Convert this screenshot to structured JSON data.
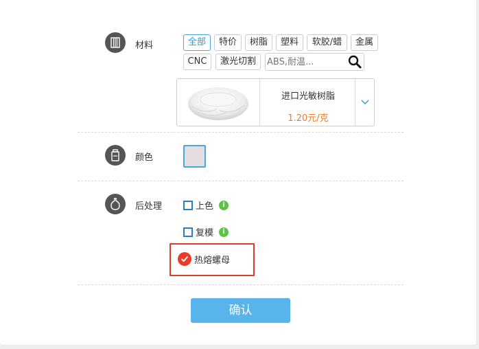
{
  "material": {
    "label": "材料",
    "chips": [
      {
        "label": "全部"
      },
      {
        "label": "特价"
      },
      {
        "label": "树脂"
      },
      {
        "label": "塑料"
      },
      {
        "label": "软胶/蜡"
      },
      {
        "label": "金属"
      },
      {
        "label": "CNC"
      },
      {
        "label": "激光切割"
      }
    ],
    "active_chip": "全部",
    "search_placeholder": "ABS,耐温...",
    "product": {
      "name": "进口光敏树脂",
      "price": "1.20元/克"
    }
  },
  "color": {
    "label": "颜色",
    "swatch_color": "#e6dede"
  },
  "post_processing": {
    "label": "后处理",
    "options": [
      {
        "label": "上色",
        "checked": false
      },
      {
        "label": "复模",
        "checked": false
      },
      {
        "label": "热熔螺母",
        "checked": true
      }
    ]
  },
  "confirm_label": "确认",
  "colors": {
    "accent": "#4aa7dd",
    "price": "#e67e2a",
    "confirm": "#5ab4ec",
    "highlight": "#e03a2a",
    "info": "#5cc547"
  }
}
